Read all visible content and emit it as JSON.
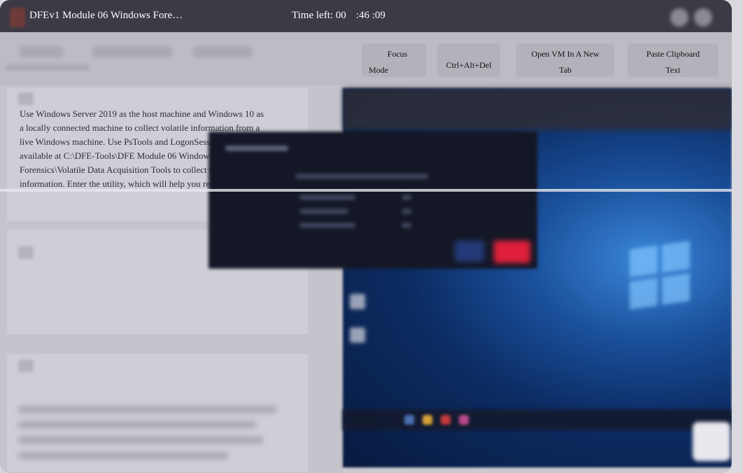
{
  "header": {
    "title": "DFEv1 Module 06 Windows Fore…",
    "timer": {
      "label": "Time left: 00",
      "minutes": ":46",
      "seconds": ":09"
    }
  },
  "toolbar": {
    "nav_arrow": "",
    "buttons": [
      {
        "line1": "Focus",
        "line2": "Mode"
      },
      {
        "line1": "",
        "line2": "Ctrl+Alt+Del"
      },
      {
        "line1": "Open VM In A New",
        "line2": "Tab"
      },
      {
        "line1": "Paste Clipboard",
        "line2": "Text"
      }
    ],
    "end_arrow": ""
  },
  "instructions": {
    "lines": [
      "Use Windows Server 2019 as the host machine and Windows 10 as",
      "a locally connected machine to collect volatile information from a",
      "live Windows machine. Use PsTools and LogonSessions tools",
      "available at C:\\DFE-Tools\\DFE Module 06 Windows",
      "Forensics\\Volatile Data Acquisition Tools to collect the volatile",
      "information. Enter the utility, which will help you retrieve information"
    ]
  },
  "colors": {
    "header_bg": "#3b3a45",
    "vm_blue": "#1a4f9a",
    "dialog_red": "#e0203a"
  }
}
